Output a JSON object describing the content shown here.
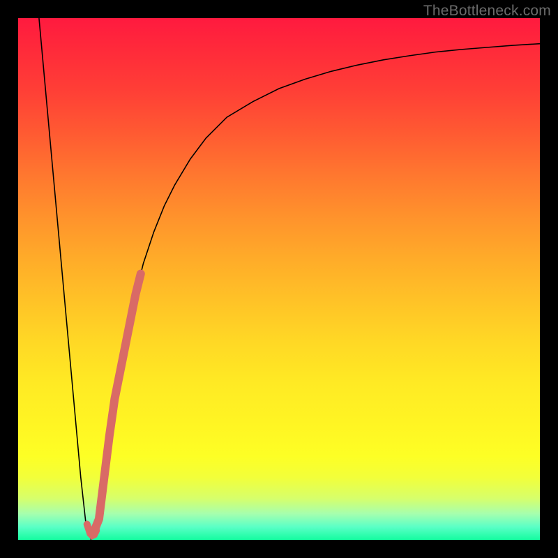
{
  "watermark": "TheBottleneck.com",
  "chart_data": {
    "type": "line",
    "title": "",
    "xlabel": "",
    "ylabel": "",
    "xlim": [
      0,
      100
    ],
    "ylim": [
      0,
      100
    ],
    "grid": false,
    "background_gradient": {
      "orientation": "vertical",
      "stops": [
        {
          "pos": 0.0,
          "color": "#ff1a3f"
        },
        {
          "pos": 0.5,
          "color": "#ffc227"
        },
        {
          "pos": 0.85,
          "color": "#fdff25"
        },
        {
          "pos": 1.0,
          "color": "#14fca0"
        }
      ]
    },
    "series": [
      {
        "name": "bottleneck-curve",
        "stroke": "#000000",
        "stroke_width": 1.6,
        "x": [
          4,
          5,
          6,
          7,
          8,
          9,
          10,
          11,
          12,
          13,
          14,
          15,
          16,
          17,
          18,
          20,
          22,
          24,
          26,
          28,
          30,
          33,
          36,
          40,
          45,
          50,
          55,
          60,
          65,
          70,
          75,
          80,
          85,
          90,
          95,
          100
        ],
        "y": [
          100,
          89,
          78,
          67,
          56,
          45,
          34,
          23,
          12,
          3,
          0,
          3,
          10,
          18,
          25,
          36,
          45,
          53,
          59,
          64,
          68,
          73,
          77,
          81,
          84,
          86.5,
          88.3,
          89.8,
          91,
          92,
          92.8,
          93.5,
          94,
          94.4,
          94.8,
          95.1
        ]
      },
      {
        "name": "highlight-band",
        "stroke": "#d96a66",
        "stroke_width": 12,
        "linecap": "round",
        "x": [
          14.5,
          15.5,
          16.5,
          17.5,
          18.5,
          19.5,
          20.5,
          21.5,
          22.5,
          23.5
        ],
        "y": [
          1.5,
          4,
          12,
          20,
          27,
          32,
          37,
          42,
          47,
          51
        ]
      },
      {
        "name": "highlight-hook",
        "stroke": "#d96a66",
        "stroke_width": 10,
        "linecap": "round",
        "x": [
          13.2,
          13.8,
          14.2,
          14.6,
          15.0
        ],
        "y": [
          3.0,
          1.2,
          0.8,
          1.0,
          1.8
        ]
      }
    ]
  }
}
